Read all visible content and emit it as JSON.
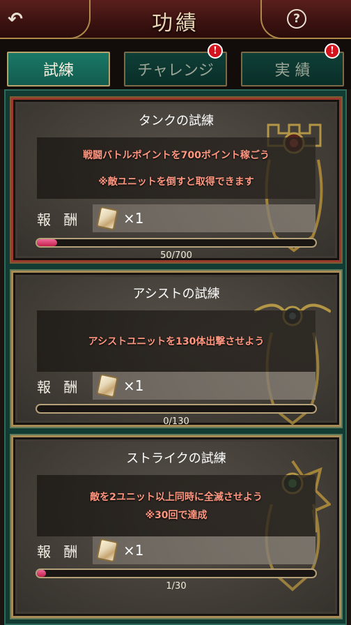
{
  "header": {
    "title": "功績",
    "back_icon": "back-arrow-icon",
    "help_label": "?"
  },
  "tabs": [
    {
      "label": "試練",
      "active": true,
      "alert": false
    },
    {
      "label": "チャレンジ",
      "active": false,
      "alert": true,
      "alert_label": "!"
    },
    {
      "label": "実 績",
      "active": false,
      "alert": true,
      "alert_label": "!"
    }
  ],
  "trials": [
    {
      "title": "タンクの試練",
      "lines": [
        "戦闘バトルポイントを700ポイント稼ごう",
        "※敵ユニットを倒すと取得できます"
      ],
      "reward_label": "報 酬",
      "reward_qty": "×1",
      "progress_text": "50/700",
      "progress_fraction": 0.0714
    },
    {
      "title": "アシストの試練",
      "lines": [
        "アシストユニットを130体出撃させよう"
      ],
      "reward_label": "報 酬",
      "reward_qty": "×1",
      "progress_text": "0/130",
      "progress_fraction": 0
    },
    {
      "title": "ストライクの試練",
      "lines": [
        "敵を2ユニット以上同時に全滅させよう",
        "※30回で達成"
      ],
      "reward_label": "報 酬",
      "reward_qty": "×1",
      "progress_text": "1/30",
      "progress_fraction": 0.0333
    }
  ]
}
